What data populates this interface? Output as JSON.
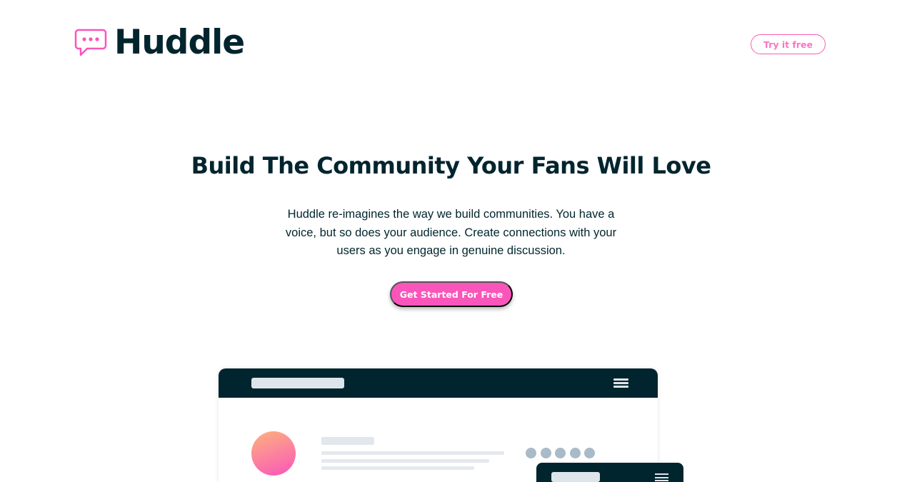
{
  "header": {
    "logo_text": "Huddle",
    "logo_icon": "chat-bubble-icon",
    "try_button_label": "Try it free"
  },
  "hero": {
    "title": "Build The Community Your Fans Will Love",
    "description": "Huddle re-imagines the way we build communities. You have a voice, but so does your audience. Create connections with your users as you engage in genuine discussion.",
    "cta_label": "Get Started For Free"
  },
  "colors": {
    "brand_dark": "#00252e",
    "accent_pink": "#fa55bb",
    "avatar_gradient_start": "#fdb37c"
  },
  "illustration": {
    "icons": [
      "menu-icon",
      "avatar-icon"
    ]
  }
}
